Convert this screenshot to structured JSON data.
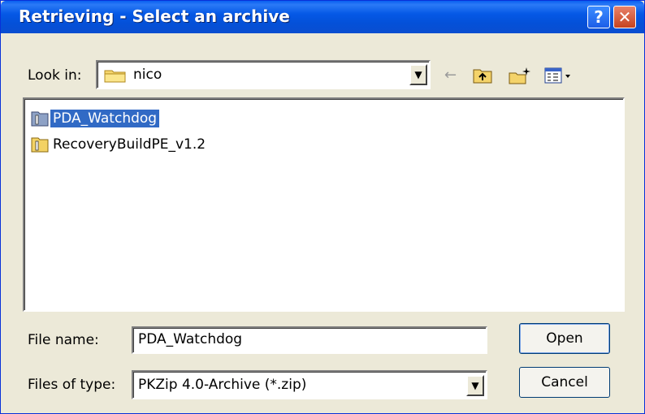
{
  "window": {
    "title": "Retrieving - Select an archive"
  },
  "titlebar": {
    "help_glyph": "?",
    "close_glyph": "✕"
  },
  "lookin": {
    "label": "Look in:",
    "value": "nico"
  },
  "toolbar": {
    "icons": [
      "back-arrow-icon",
      "up-folder-icon",
      "new-folder-icon",
      "view-menu-icon"
    ]
  },
  "files": [
    {
      "name": "PDA_Watchdog",
      "selected": true
    },
    {
      "name": "RecoveryBuildPE_v1.2",
      "selected": false
    }
  ],
  "filename": {
    "label": "File name:",
    "value": "PDA_Watchdog"
  },
  "filetype": {
    "label": "Files of type:",
    "value": "PKZip 4.0-Archive (*.zip)"
  },
  "buttons": {
    "open": "Open",
    "cancel": "Cancel"
  },
  "colors": {
    "title_bar": "#0558e6",
    "selection": "#316ac5",
    "dialog_bg": "#ece9d8"
  }
}
